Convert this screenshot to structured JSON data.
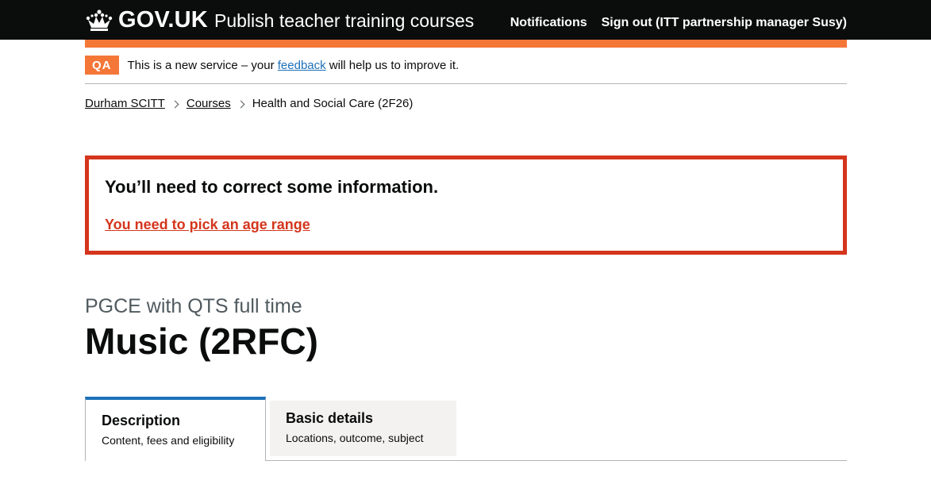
{
  "header": {
    "logo_text": "GOV.UK",
    "service_name": "Publish teacher training courses",
    "nav": [
      {
        "label": "Notifications"
      },
      {
        "label": "Sign out (ITT partnership manager Susy)"
      }
    ]
  },
  "phase_banner": {
    "tag": "QA",
    "text_before": "This is a new service – your ",
    "link": "feedback",
    "text_after": " will help us to improve it."
  },
  "breadcrumbs": [
    {
      "label": "Durham SCITT"
    },
    {
      "label": "Courses"
    },
    {
      "label": "Health and Social Care (2F26)"
    }
  ],
  "error_summary": {
    "title": "You’ll need to correct some information.",
    "errors": [
      "You need to pick an age range"
    ]
  },
  "course": {
    "caption": "PGCE with QTS full time",
    "title": "Music (2RFC)"
  },
  "tabs": [
    {
      "title": "Description",
      "subtitle": "Content, fees and eligibility",
      "active": true
    },
    {
      "title": "Basic details",
      "subtitle": "Locations, outcome, subject",
      "active": false
    }
  ],
  "colors": {
    "header_bg": "#0b0c0c",
    "phase_orange": "#f47738",
    "error_red": "#d4351c",
    "link_blue": "#1d70b8",
    "tab_inactive_bg": "#f3f2f1"
  }
}
